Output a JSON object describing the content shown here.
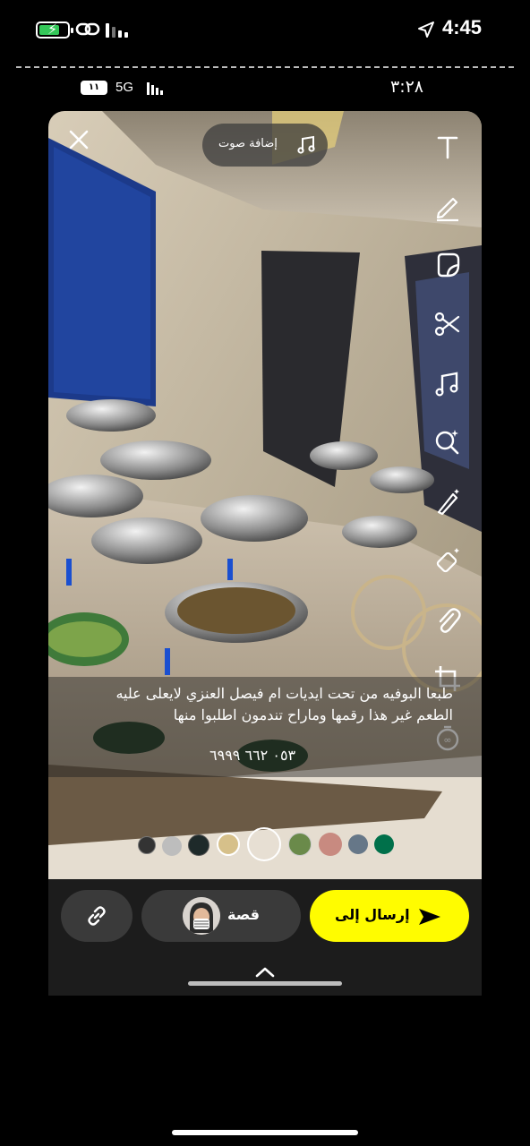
{
  "status_bar": {
    "time": "4:45"
  },
  "inner_status": {
    "battery_level": "١١",
    "network": "5G",
    "time": "٣:٢٨"
  },
  "snap": {
    "add_sound_label": "إضافة صوت",
    "caption_line1": "طبعا البوفيه من تحت ايديات ام فيصل العنزي  لايعلى عليه",
    "caption_line2": "الطعم غير هذا رقمها وماراح تندمون اطلبوا منها",
    "caption_phone": "٠٥٣ ٦٦٢ ٦٩٩٩",
    "tools": [
      "text-tool",
      "pen-tool",
      "sticker-tool",
      "scissors-tool",
      "music-tool",
      "lens-tool",
      "magic-wand-tool",
      "eraser-tool",
      "paperclip-tool",
      "crop-tool",
      "timer-tool"
    ],
    "filters": [
      "filter-1",
      "filter-2",
      "filter-3",
      "filter-4",
      "filter-selected",
      "filter-5",
      "filter-6",
      "filter-7",
      "filter-8"
    ]
  },
  "bottom_bar": {
    "story_label": "قصة",
    "send_label": "إرسال إلى"
  },
  "colors": {
    "send_button": "#fffc00",
    "battery_green": "#34c759",
    "pill_bg": "#3a3a3a"
  }
}
